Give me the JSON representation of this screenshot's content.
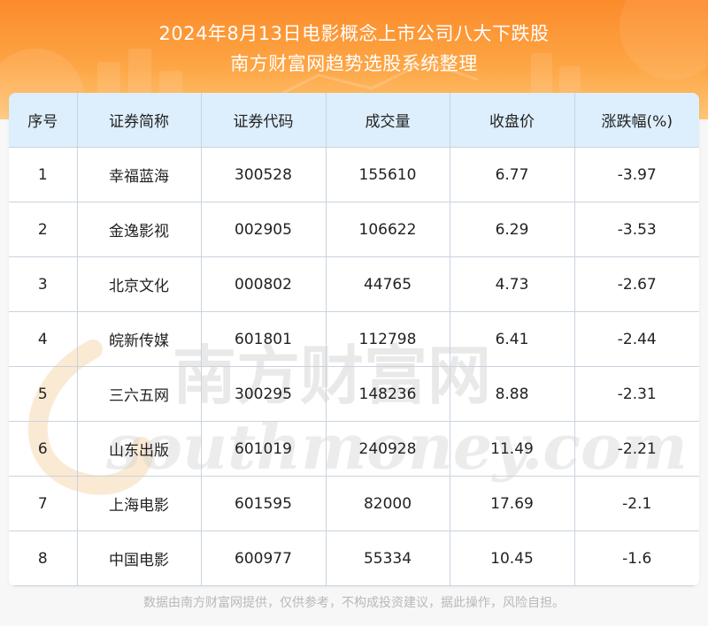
{
  "header": {
    "title_line1": "2024年8月13日电影概念上市公司八大下跌股",
    "title_line2": "南方财富网趋势选股系统整理"
  },
  "table": {
    "columns": [
      "序号",
      "证券简称",
      "证券代码",
      "成交量",
      "收盘价",
      "涨跌幅(%)"
    ],
    "rows": [
      [
        "1",
        "幸福蓝海",
        "300528",
        "155610",
        "6.77",
        "-3.97"
      ],
      [
        "2",
        "金逸影视",
        "002905",
        "106622",
        "6.29",
        "-3.53"
      ],
      [
        "3",
        "北京文化",
        "000802",
        "44765",
        "4.73",
        "-2.67"
      ],
      [
        "4",
        "皖新传媒",
        "601801",
        "112798",
        "6.41",
        "-2.44"
      ],
      [
        "5",
        "三六五网",
        "300295",
        "148236",
        "8.88",
        "-2.31"
      ],
      [
        "6",
        "山东出版",
        "601019",
        "240928",
        "11.49",
        "-2.21"
      ],
      [
        "7",
        "上海电影",
        "601595",
        "82000",
        "17.69",
        "-2.1"
      ],
      [
        "8",
        "中国电影",
        "600977",
        "55334",
        "10.45",
        "-1.6"
      ]
    ]
  },
  "watermark": {
    "cn_text": "南方财富网",
    "en_text": "southmoney.com"
  },
  "footer": {
    "disclaimer": "数据由南方财富网提供，仅供参考，不构成投资建议，据此操作，风险自担。"
  },
  "colors": {
    "header_orange": "#fc8b2b",
    "header_light": "#ffc677",
    "table_header_bg": "#ddeefc",
    "grid_line": "#c9d3de",
    "watermark": "#d9d9d9"
  }
}
